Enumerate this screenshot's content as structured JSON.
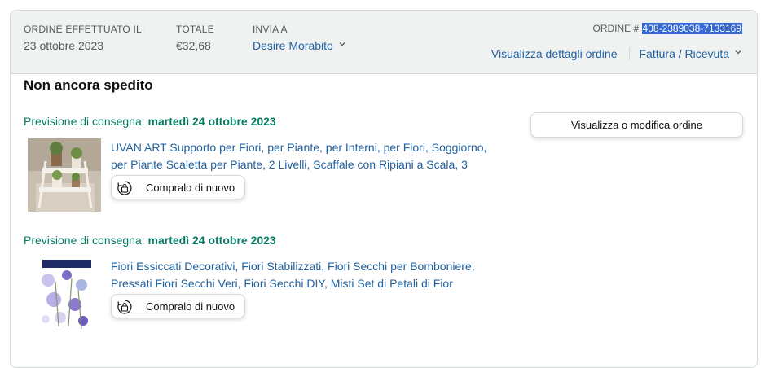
{
  "header": {
    "placed_label": "ORDINE EFFETTUATO IL:",
    "placed_value": "23 ottobre 2023",
    "total_label": "TOTALE",
    "total_value": "€32,68",
    "ship_label": "INVIA A",
    "ship_value": "Desire Morabito",
    "order_label": "ORDINE #",
    "order_number": "408-2389038-7133169",
    "details_link": "Visualizza dettagli ordine",
    "invoice_link": "Fattura / Ricevuta"
  },
  "shipment": {
    "status_title": "Non ancora spedito",
    "view_edit_button": "Visualizza o modifica ordine"
  },
  "items": [
    {
      "delivery_prefix": "Previsione di consegna:",
      "delivery_date": "martedì 24 ottobre 2023",
      "title": "UVAN ART Supporto per Fiori, per Piante, per Interni, per Fiori, Soggiorno, per Piante Scaletta per Piante, 2 Livelli, Scaffale con Ripiani a Scala, 3",
      "buy_again_label": "Compralo di nuovo"
    },
    {
      "delivery_prefix": "Previsione di consegna:",
      "delivery_date": "martedì 24 ottobre 2023",
      "title": "Fiori Essiccati Decorativi, Fiori Stabilizzati, Fiori Secchi per Bomboniere, Pressati Fiori Secchi Veri, Fiori Secchi DIY, Misti Set di Petali di Fior",
      "buy_again_label": "Compralo di nuovo"
    }
  ],
  "colors": {
    "link": "#2162a1",
    "delivery_green": "#067d62",
    "header_bg": "#f0f2f2",
    "selection": "#3367d6"
  },
  "icons": [
    "chevron-down-icon",
    "buy-again-icon"
  ]
}
